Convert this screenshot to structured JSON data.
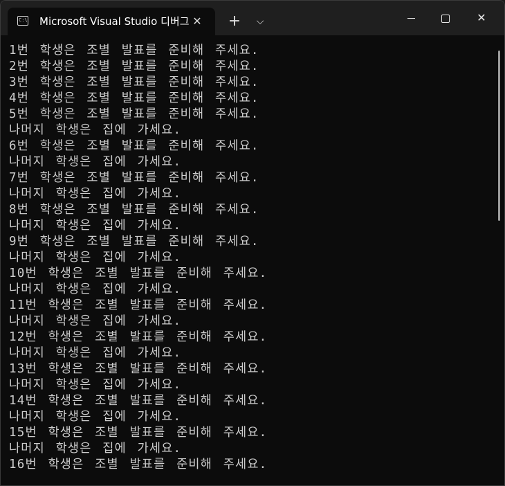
{
  "window": {
    "tab_title": "Microsoft Visual Studio 디버그",
    "tab_icon_text": "C:\\",
    "close_tab_glyph": "✕",
    "new_tab_glyph": "+",
    "dropdown_glyph": "⌵",
    "close_window_glyph": "✕"
  },
  "console": {
    "lines": [
      "1번 학생은 조별 발표를 준비해 주세요.",
      "2번 학생은 조별 발표를 준비해 주세요.",
      "3번 학생은 조별 발표를 준비해 주세요.",
      "4번 학생은 조별 발표를 준비해 주세요.",
      "5번 학생은 조별 발표를 준비해 주세요.",
      "나머지 학생은 집에 가세요.",
      "6번 학생은 조별 발표를 준비해 주세요.",
      "나머지 학생은 집에 가세요.",
      "7번 학생은 조별 발표를 준비해 주세요.",
      "나머지 학생은 집에 가세요.",
      "8번 학생은 조별 발표를 준비해 주세요.",
      "나머지 학생은 집에 가세요.",
      "9번 학생은 조별 발표를 준비해 주세요.",
      "나머지 학생은 집에 가세요.",
      "10번 학생은 조별 발표를 준비해 주세요.",
      "나머지 학생은 집에 가세요.",
      "11번 학생은 조별 발표를 준비해 주세요.",
      "나머지 학생은 집에 가세요.",
      "12번 학생은 조별 발표를 준비해 주세요.",
      "나머지 학생은 집에 가세요.",
      "13번 학생은 조별 발표를 준비해 주세요.",
      "나머지 학생은 집에 가세요.",
      "14번 학생은 조별 발표를 준비해 주세요.",
      "나머지 학생은 집에 가세요.",
      "15번 학생은 조별 발표를 준비해 주세요.",
      "나머지 학생은 집에 가세요.",
      "16번 학생은 조별 발표를 준비해 주세요."
    ]
  },
  "colors": {
    "terminal_bg": "#0c0c0c",
    "titlebar_bg": "#1f1f1f",
    "text": "#cccccc"
  }
}
